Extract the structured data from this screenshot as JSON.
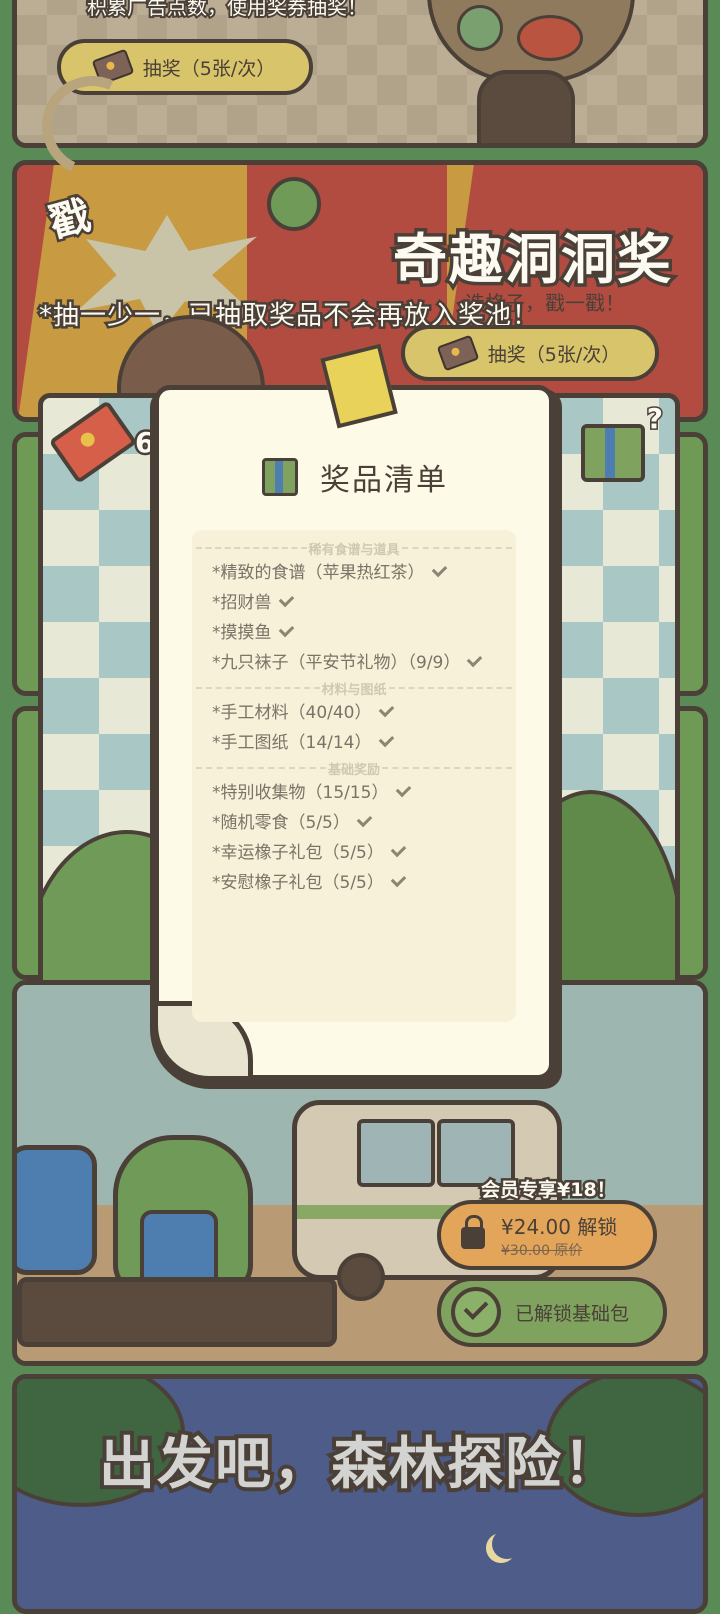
{
  "card_lottery": {
    "description_partial": "积累广告点数，使用奖券抽奖！",
    "button_label": "抽奖（5张/次）"
  },
  "card_holes": {
    "poke_text": "戳",
    "title": "奇趣洞洞奖",
    "subtitle_partial": "选格子，戳一戳！",
    "notice": "*抽一少一，已抽取奖品不会再放入奖池！",
    "button_label": "抽奖（5张/次）"
  },
  "board": {
    "ticket_count_partial": "6"
  },
  "prize_modal": {
    "title": "奖品清单",
    "sections": [
      {
        "header": "稀有食谱与道具",
        "items": [
          "*精致的食谱（苹果热红茶）",
          "*招财兽",
          "*摸摸鱼",
          "*九只袜子（平安节礼物）（9/9）"
        ]
      },
      {
        "header": "材料与图纸",
        "items": [
          "*手工材料（40/40）",
          "*手工图纸（14/14）"
        ]
      },
      {
        "header": "基础奖励",
        "items": [
          "*特别收集物（15/15）",
          "*随机零食（5/5）",
          "*幸运橡子礼包（5/5）",
          "*安慰橡子礼包（5/5）"
        ]
      }
    ]
  },
  "card_bus": {
    "member_badge": "会员专享¥18！",
    "unlock_button_label": "¥24.00 解锁",
    "original_price": "¥30.00 原价",
    "unlocked_button_label": "已解锁基础包"
  },
  "card_forest": {
    "title": "出发吧，森林探险！"
  },
  "colors": {
    "border": "#4a4038",
    "paper": "#fdfbe8",
    "button_yellow": "#d8c46a",
    "button_green": "#7fa35e",
    "banner_red": "#b24c40",
    "forest_blue": "#4e5c8a"
  },
  "icons": [
    "ticket-icon",
    "gift-icon",
    "mystery-gift-icon",
    "lock-icon",
    "check-circle-icon",
    "check-icon"
  ]
}
